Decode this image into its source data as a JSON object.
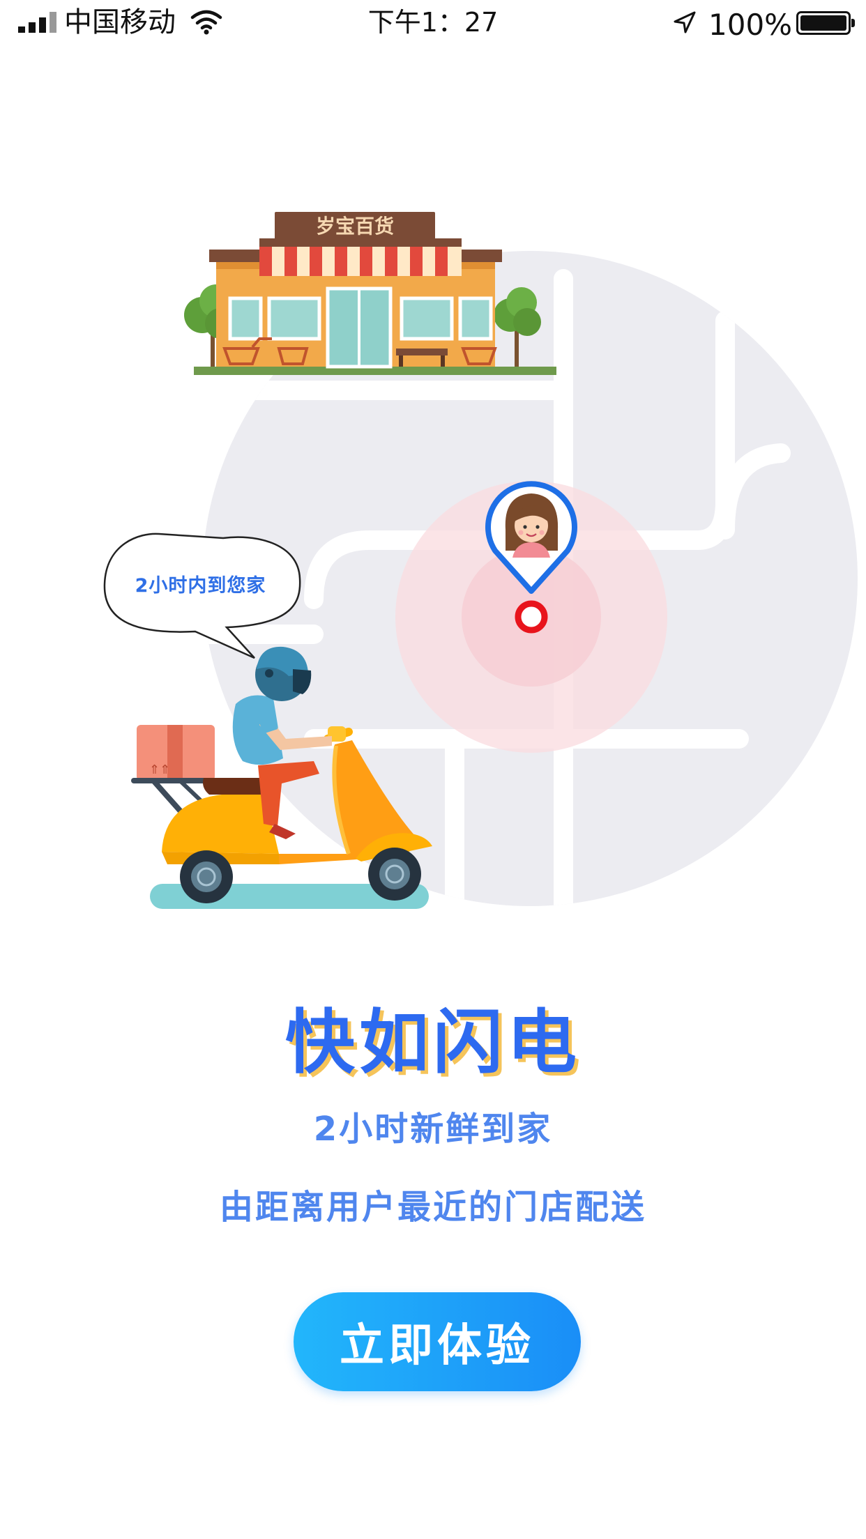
{
  "status_bar": {
    "carrier": "中国移动",
    "time": "下午1：27",
    "battery_percent_label": "100%",
    "battery_level": 1.0,
    "signal_bars": 4,
    "icons": [
      "signal-icon",
      "wifi-icon",
      "location-arrow-icon",
      "battery-icon"
    ]
  },
  "illustration": {
    "store_sign": "岁宝百货",
    "speech_bubble": "2小时内到您家"
  },
  "content": {
    "title": "快如闪电",
    "subtitle": "2小时新鲜到家",
    "description": "由距离用户最近的门店配送"
  },
  "cta": {
    "label": "立即体验"
  },
  "colors": {
    "primary": "#2d6af0",
    "text_blue": "#4f86ee",
    "title_shadow": "#f5c45a",
    "button_start": "#22b6fb",
    "button_end": "#1a8ef7",
    "map_bg": "#ececf1",
    "pin_ring": "#1e6fe6",
    "target_red": "#e8141c"
  }
}
